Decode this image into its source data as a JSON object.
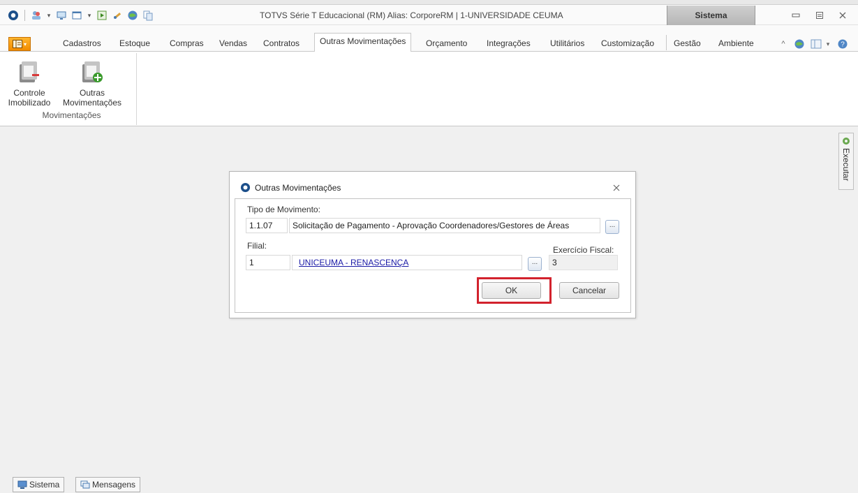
{
  "window": {
    "title": "TOTVS Série T Educacional (RM) Alias: CorporeRM | 1-UNIVERSIDADE CEUMA",
    "context_tab": "Sistema"
  },
  "menu": {
    "tabs": [
      "Cadastros",
      "Estoque",
      "Compras",
      "Vendas",
      "Contratos",
      "Outras Movimentações",
      "Orçamento",
      "Integrações",
      "Utilitários",
      "Customização"
    ],
    "active_tab": "Outras Movimentações",
    "context_tabs": [
      "Gestão",
      "Ambiente"
    ]
  },
  "ribbon": {
    "group_label": "Movimentações",
    "buttons": [
      {
        "line1": "Controle",
        "line2": "Imobilizado"
      },
      {
        "line1": "Outras",
        "line2": "Movimentações"
      }
    ]
  },
  "side_panel": {
    "label": "Executar"
  },
  "dialog": {
    "title": "Outras Movimentações",
    "tipo_label": "Tipo de Movimento:",
    "tipo_code": "1.1.07",
    "tipo_desc": "Solicitação de Pagamento - Aprovação Coordenadores/Gestores de Áreas",
    "filial_label": "Filial:",
    "filial_code": "1",
    "filial_name": "UNICEUMA - RENASCENÇA",
    "exercicio_label": "Exercício Fiscal:",
    "exercicio_value": "3",
    "lookup_label": "...",
    "ok_label": "OK",
    "cancel_label": "Cancelar"
  },
  "bottom_tabs": [
    "Sistema",
    "Mensagens"
  ],
  "colors": {
    "highlight": "#d2222d",
    "app_button": "#f28c00",
    "link": "#1a1aa6"
  }
}
